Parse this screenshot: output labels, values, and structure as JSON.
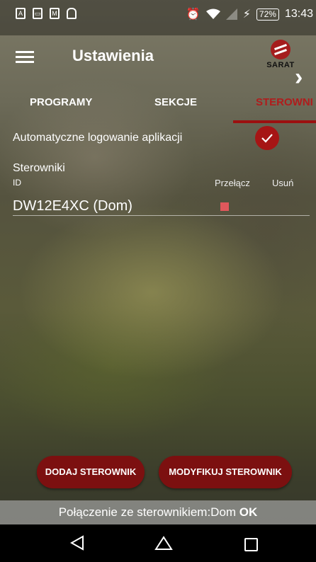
{
  "status_bar": {
    "battery": "72%",
    "time": "13:43",
    "left_icons": [
      "a-icon",
      "image-icon",
      "gmail-icon",
      "android-icon"
    ],
    "right_icons": [
      "alarm-icon",
      "wifi-icon",
      "signal-icon",
      "charging-icon"
    ]
  },
  "toolbar": {
    "title": "Ustawienia",
    "logo_text": "SARAT"
  },
  "tabs": [
    {
      "label": "PROGRAMY",
      "active": false
    },
    {
      "label": "SEKCJE",
      "active": false
    },
    {
      "label": "STEROWNI",
      "active": true
    }
  ],
  "settings": {
    "auto_login_label": "Automatyczne logowanie aplikacji",
    "auto_login_checked": true,
    "controllers_title": "Sterowniki",
    "col_id": "ID",
    "col_switch": "Przełącz",
    "col_delete": "Usuń"
  },
  "controllers": [
    {
      "name": "DW12E4XC (Dom)",
      "switch_on": true
    }
  ],
  "buttons": {
    "add": "DODAJ STEROWNIK",
    "modify": "MODYFIKUJ STEROWNIK"
  },
  "connection": {
    "prefix": "Połączenie ze sterownikiem:Dom ",
    "status": "OK"
  },
  "colors": {
    "accent": "#9c1010",
    "switch": "#e0585c"
  }
}
